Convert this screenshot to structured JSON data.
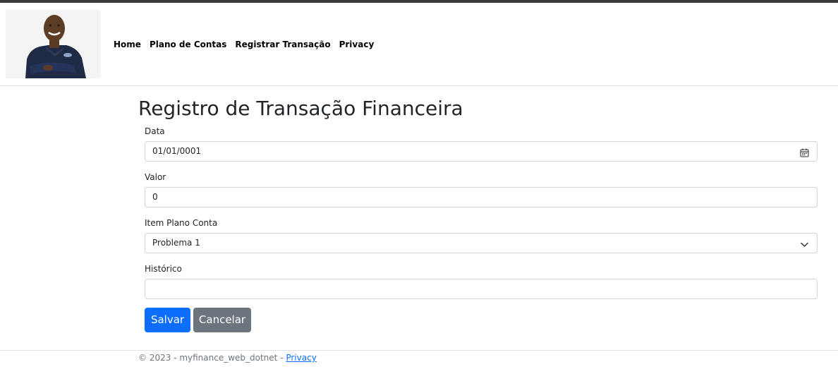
{
  "nav": {
    "items": [
      {
        "label": "Home"
      },
      {
        "label": "Plano de Contas"
      },
      {
        "label": "Registrar Transação"
      },
      {
        "label": "Privacy"
      }
    ]
  },
  "page": {
    "title": "Registro de Transação Financeira"
  },
  "form": {
    "data": {
      "label": "Data",
      "value": "01/01/0001",
      "icon": "calendar-icon"
    },
    "valor": {
      "label": "Valor",
      "value": "0"
    },
    "item_plano_conta": {
      "label": "Item Plano Conta",
      "selected": "Problema 1",
      "icon": "chevron-down-icon"
    },
    "historico": {
      "label": "Histórico",
      "value": ""
    },
    "save_label": "Salvar",
    "cancel_label": "Cancelar"
  },
  "footer": {
    "text": "© 2023 - myfinance_web_dotnet - ",
    "link": "Privacy"
  },
  "colors": {
    "primary": "#0d6efd",
    "secondary": "#6c757d",
    "border": "#ced4da",
    "topbar": "#3a3a3a"
  }
}
